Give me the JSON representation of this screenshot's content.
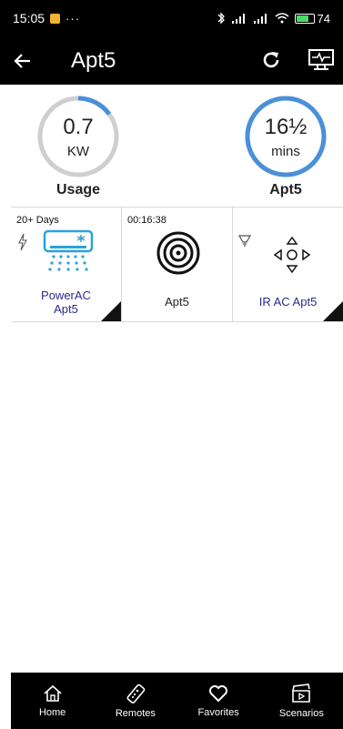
{
  "status": {
    "time": "15:05",
    "more": "···",
    "battery": "74"
  },
  "header": {
    "title": "Apt5"
  },
  "gauges": [
    {
      "value": "0.7",
      "unit": "KW",
      "caption": "Usage",
      "progress": 0.15,
      "color": "#4a90d9"
    },
    {
      "value": "16½",
      "unit": "mins",
      "caption": "Apt5",
      "progress": 1.0,
      "color": "#4a90d9"
    }
  ],
  "tiles": [
    {
      "top": "20+ Days",
      "label_line1": "PowerAC",
      "label_line2": "Apt5",
      "icon": "air-conditioner-icon"
    },
    {
      "top": "00:16:38",
      "label_line1": "Apt5",
      "icon": "target-icon"
    },
    {
      "label_line1": "IR AC Apt5",
      "icon": "direction-pad-icon"
    }
  ],
  "nav": [
    {
      "label": "Home",
      "icon": "home-icon"
    },
    {
      "label": "Remotes",
      "icon": "remote-icon"
    },
    {
      "label": "Favorites",
      "icon": "heart-icon"
    },
    {
      "label": "Scenarios",
      "icon": "clapperboard-icon"
    }
  ]
}
